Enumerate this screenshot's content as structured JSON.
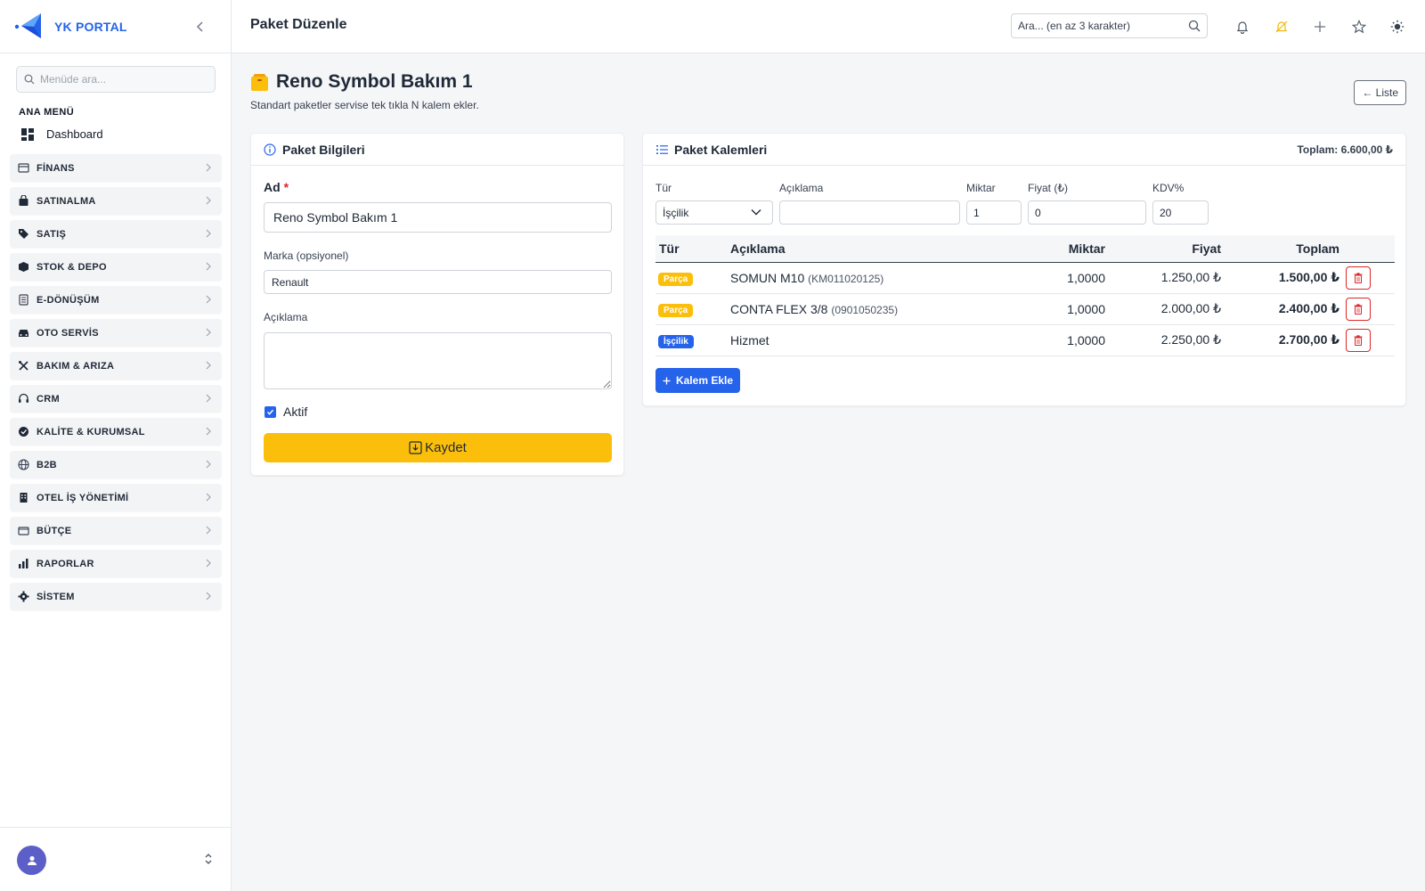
{
  "brand": {
    "name": "YK PORTAL"
  },
  "sidebar": {
    "search_placeholder": "Menüde ara...",
    "section_label": "ANA MENÜ",
    "dashboard_label": "Dashboard",
    "items": [
      {
        "label": "FİNANS",
        "icon": "finance-icon"
      },
      {
        "label": "SATINALMA",
        "icon": "bag-icon"
      },
      {
        "label": "SATIŞ",
        "icon": "tag-icon"
      },
      {
        "label": "STOK & DEPO",
        "icon": "box-icon"
      },
      {
        "label": "E-DÖNÜŞÜM",
        "icon": "document-icon"
      },
      {
        "label": "OTO SERVİS",
        "icon": "car-icon"
      },
      {
        "label": "BAKIM & ARIZA",
        "icon": "tools-icon"
      },
      {
        "label": "CRM",
        "icon": "headset-icon"
      },
      {
        "label": "KALİTE & KURUMSAL",
        "icon": "badge-check-icon"
      },
      {
        "label": "B2B",
        "icon": "globe-icon"
      },
      {
        "label": "OTEL İŞ YÖNETİMİ",
        "icon": "building-icon"
      },
      {
        "label": "BÜTÇE",
        "icon": "wallet-icon"
      },
      {
        "label": "RAPORLAR",
        "icon": "bar-chart-icon"
      },
      {
        "label": "SİSTEM",
        "icon": "gear-icon"
      }
    ]
  },
  "header": {
    "title": "Paket Düzenle",
    "search_placeholder": "Ara... (en az 3 karakter)"
  },
  "page": {
    "title": "Reno Symbol Bakım 1",
    "subtitle": "Standart paketler servise tek tıkla N kalem ekler.",
    "list_button": "← Liste"
  },
  "package_info": {
    "title": "Paket Bilgileri",
    "name_label": "Ad",
    "required_mark": "*",
    "name_value": "Reno Symbol Bakım 1",
    "brand_label": "Marka (opsiyonel)",
    "brand_value": "Renault",
    "description_label": "Açıklama",
    "description_value": "",
    "active_label": "Aktif",
    "active_checked": true,
    "save_label": "Kaydet"
  },
  "package_items": {
    "title": "Paket Kalemleri",
    "total": "Toplam: 6.600,00 ₺",
    "form": {
      "type_label": "Tür",
      "type_value": "İşçilik",
      "description_label": "Açıklama",
      "description_value": "",
      "quantity_label": "Miktar",
      "quantity_value": "1",
      "price_label": "Fiyat (₺)",
      "price_value": "0",
      "vat_label": "KDV%",
      "vat_value": "20"
    },
    "columns": [
      "Tür",
      "Açıklama",
      "Miktar",
      "Fiyat",
      "Toplam"
    ],
    "rows": [
      {
        "type": "Parça",
        "kind": "parca",
        "description": "SOMUN M10",
        "code": "(KM011020125)",
        "quantity": "1,0000",
        "price": "1.250,00 ₺",
        "total": "1.500,00 ₺"
      },
      {
        "type": "Parça",
        "kind": "parca",
        "description": "CONTA FLEX 3/8",
        "code": "(0901050235)",
        "quantity": "1,0000",
        "price": "2.000,00 ₺",
        "total": "2.400,00 ₺"
      },
      {
        "type": "İşçilik",
        "kind": "iscilik",
        "description": "Hizmet",
        "code": "",
        "quantity": "1,0000",
        "price": "2.250,00 ₺",
        "total": "2.700,00 ₺"
      }
    ],
    "add_button": "Kalem Ekle"
  },
  "colors": {
    "accent": "#2563eb",
    "warning": "#fbbf0b",
    "danger": "#dc2626",
    "avatar": "#5b5fc7"
  }
}
